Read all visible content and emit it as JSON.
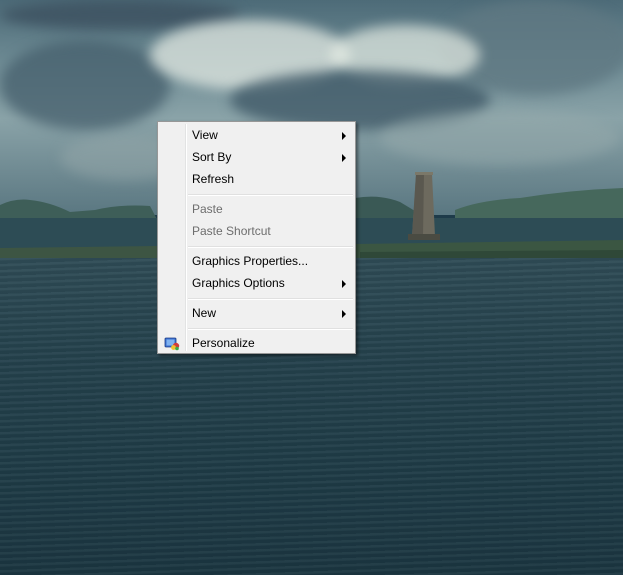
{
  "desktop": {
    "wallpaper": "coastal-seascape-with-stone-tower"
  },
  "context_menu": {
    "items": [
      {
        "label": "View",
        "submenu": true,
        "enabled": true
      },
      {
        "label": "Sort By",
        "submenu": true,
        "enabled": true
      },
      {
        "label": "Refresh",
        "submenu": false,
        "enabled": true
      },
      {
        "label": "Paste",
        "submenu": false,
        "enabled": false
      },
      {
        "label": "Paste Shortcut",
        "submenu": false,
        "enabled": false
      },
      {
        "label": "Graphics Properties...",
        "submenu": false,
        "enabled": true
      },
      {
        "label": "Graphics Options",
        "submenu": true,
        "enabled": true
      },
      {
        "label": "New",
        "submenu": true,
        "enabled": true
      },
      {
        "label": "Personalize",
        "submenu": false,
        "enabled": true,
        "icon": "personalize-icon"
      }
    ]
  },
  "colors": {
    "menu_background": "#f0f0f0",
    "menu_border": "#979797",
    "disabled_text": "#6d6d6d"
  }
}
